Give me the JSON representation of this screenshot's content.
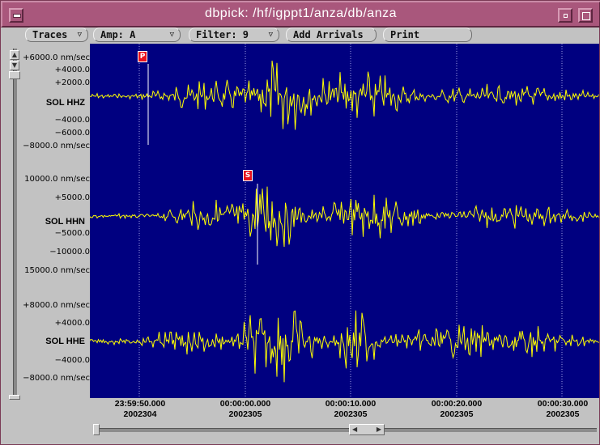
{
  "window": {
    "title": "dbpick: /hf/igppt1/anza/db/anza"
  },
  "toolbar": {
    "traces_label": "Traces",
    "amp_label": "Amp: A",
    "filter_label": "Filter: 9",
    "add_arrivals_label": "Add Arrivals",
    "print_label": "Print",
    "dropdown_arrow": "▽"
  },
  "colors": {
    "background": "#000080",
    "trace": "#ffff00",
    "pick": "#e8121e",
    "titlebar": "#a9577c"
  },
  "traces": [
    {
      "station": "SOL HHZ",
      "amp_labels": [
        "+6000.0 nm/sec",
        "+4000.0",
        "+2000.0",
        "−4000.0",
        "−6000.0",
        "−8000.0 nm/sec"
      ],
      "pick": "P"
    },
    {
      "station": "SOL HHN",
      "amp_labels": [
        "10000.0 nm/sec",
        "+5000.0",
        "−5000.0",
        "−10000.0",
        "15000.0 nm/sec"
      ],
      "pick": "S"
    },
    {
      "station": "SOL HHE",
      "amp_labels": [
        "+8000.0 nm/sec",
        "+4000.0",
        "−4000.0",
        "−8000.0 nm/sec"
      ],
      "pick": ""
    }
  ],
  "time_axis": [
    {
      "time": "23:59:50.000",
      "date": "2002304"
    },
    {
      "time": "00:00:00.000",
      "date": "2002305"
    },
    {
      "time": "00:00:10.000",
      "date": "2002305"
    },
    {
      "time": "00:00:20.000",
      "date": "2002305"
    },
    {
      "time": "00:00:30.000",
      "date": "2002305"
    }
  ]
}
